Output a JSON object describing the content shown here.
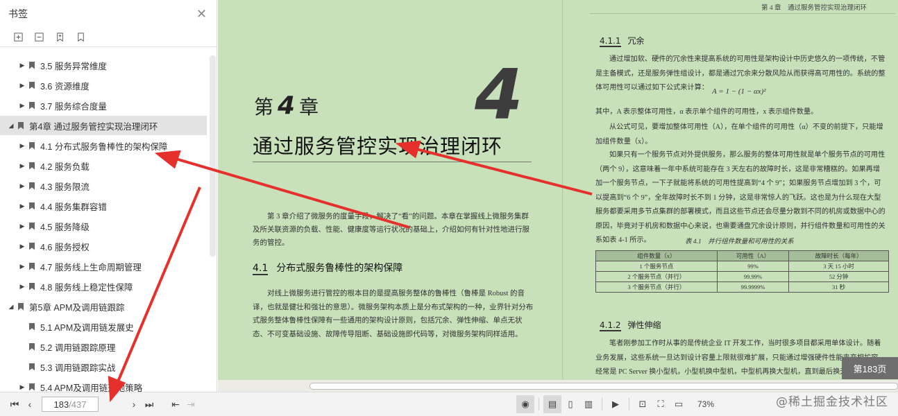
{
  "sidebar": {
    "title": "书签",
    "close_icon": "close-icon",
    "bookmarks": [
      {
        "label": "3.5 服务异常维度",
        "level": 2,
        "expandable": true
      },
      {
        "label": "3.6 资源维度",
        "level": 2,
        "expandable": true
      },
      {
        "label": "3.7 服务综合度量",
        "level": 2,
        "expandable": true
      },
      {
        "label": "第4章 通过服务管控实现治理闭环",
        "level": 1,
        "expandable": true,
        "expanded": true,
        "selected": true
      },
      {
        "label": "4.1 分布式服务鲁棒性的架构保障",
        "level": 2,
        "expandable": true
      },
      {
        "label": "4.2 服务负载",
        "level": 2,
        "expandable": true
      },
      {
        "label": "4.3 服务限流",
        "level": 2,
        "expandable": true
      },
      {
        "label": "4.4 服务集群容错",
        "level": 2,
        "expandable": true
      },
      {
        "label": "4.5 服务降级",
        "level": 2,
        "expandable": true
      },
      {
        "label": "4.6 服务授权",
        "level": 2,
        "expandable": true
      },
      {
        "label": "4.7 服务线上生命周期管理",
        "level": 2,
        "expandable": true
      },
      {
        "label": "4.8 服务线上稳定性保障",
        "level": 2,
        "expandable": true
      },
      {
        "label": "第5章 APM及调用链跟踪",
        "level": 1,
        "expandable": true,
        "expanded": true
      },
      {
        "label": "5.1 APM及调用链发展史",
        "level": 2,
        "expandable": false
      },
      {
        "label": "5.2 调用链跟踪原理",
        "level": 2,
        "expandable": false
      },
      {
        "label": "5.3 调用链跟踪实战",
        "level": 2,
        "expandable": false
      },
      {
        "label": "5.4 APM及调用链落地策略",
        "level": 2,
        "expandable": true
      }
    ]
  },
  "left_page": {
    "chapter_prefix": "第",
    "chapter_num": "4",
    "chapter_suffix": "章",
    "chapter_big_num": "4",
    "chapter_title": "通过服务管控实现治理闭环",
    "intro": "第 3 章介绍了微服务的度量手段，解决了“看”的问题。本章在掌握线上微服务集群及所关联资源的负载、性能、健康度等运行状况的基础上，介绍如何有针对性地进行服务的管控。",
    "section_num": "4.1",
    "section_title": "分布式服务鲁棒性的架构保障",
    "section_body": "对线上微服务进行管控的根本目的是提高服务整体的鲁棒性（鲁棒是 Robust 的音译，也就是健壮和强壮的意思）。微服务架构本质上是分布式架构的一种，业界针对分布式服务整体鲁棒性保障有一些通用的架构设计原则，包括冗余、弹性伸缩、单点无状态、不可变基础设施、故障传导阻断、基础设施即代码等，对微服务架构同样适用。"
  },
  "right_page": {
    "header": "第 4 章　通过服务管控实现治理闭环",
    "sub1_num": "4.1.1",
    "sub1_title": "冗余",
    "p1": "通过增加软、硬件的冗余性来提高系统的可用性是架构设计中历史悠久的一项传统，不管是主备模式，还是服务弹性组设计，都是通过冗余来分散风险从而获得高可用性的。系统的整体可用性可以通过如下公式来计算：",
    "formula": "A = 1 − (1 − αx)²",
    "p2": "其中，A 表示整体可用性，α 表示单个组件的可用性，x 表示组件数量。",
    "p3": "从公式可见，要增加整体可用性（A），在单个组件的可用性（α）不变的前提下，只能增加组件数量（x）。",
    "p4": "如果只有一个服务节点对外提供服务，那么服务的整体可用性就是单个服务节点的可用性（两个 9），这意味着一年中系统可能存在 3 天左右的故障时长，这是非常糟糕的。如果再增加一个服务节点，一下子就能将系统的可用性提高到“4 个 9”；如果服务节点增加到 3 个，可以提高到“6 个 9”，全年故障时长不到 1 分钟，这是非常惊人的飞跃。这也是为什么现在大型服务都要采用多节点集群的部署模式，而且这些节点还会尽量分散到不同的机房或数据中心的原因，毕竟对于机房和数据中心来说，也需要通盘冗余设计原则，并行组件数量和可用性的关系如表 4-1 所示。",
    "table_caption": "表 4.1　并行组件数量和可用性的关系",
    "table_headers": [
      "组件数量（x）",
      "可用性（A）",
      "故障时长（每年）"
    ],
    "table_rows": [
      [
        "1 个服务节点",
        "99%",
        "3 天 15 小时"
      ],
      [
        "2 个服务节点（并行）",
        "99.99%",
        "52 分钟"
      ],
      [
        "3 个服务节点（并行）",
        "99.9999%",
        "31 秒"
      ]
    ],
    "sub2_num": "4.1.2",
    "sub2_title": "弹性伸缩",
    "p5": "笔者刚参加工作时从事的是传统企业 IT 开发工作，当时很多项目都采用单体设计。随着业务发展，这些系统一旦达到设计容量上限就很难扩展，只能通过增强硬件性能来变相扩容，经常是 PC Server 换小型机，小型机换中型机，中型机再换大型机，直到最后换无可换，只能重新"
  },
  "page_badge": "第183页",
  "toolbar": {
    "current_page": "183",
    "total_pages": "/437",
    "zoom": "73%"
  },
  "watermark": "@稀土掘金技术社区",
  "colors": {
    "page_bg": "#c8e1bb",
    "annotation_arrow": "#e5302b"
  }
}
